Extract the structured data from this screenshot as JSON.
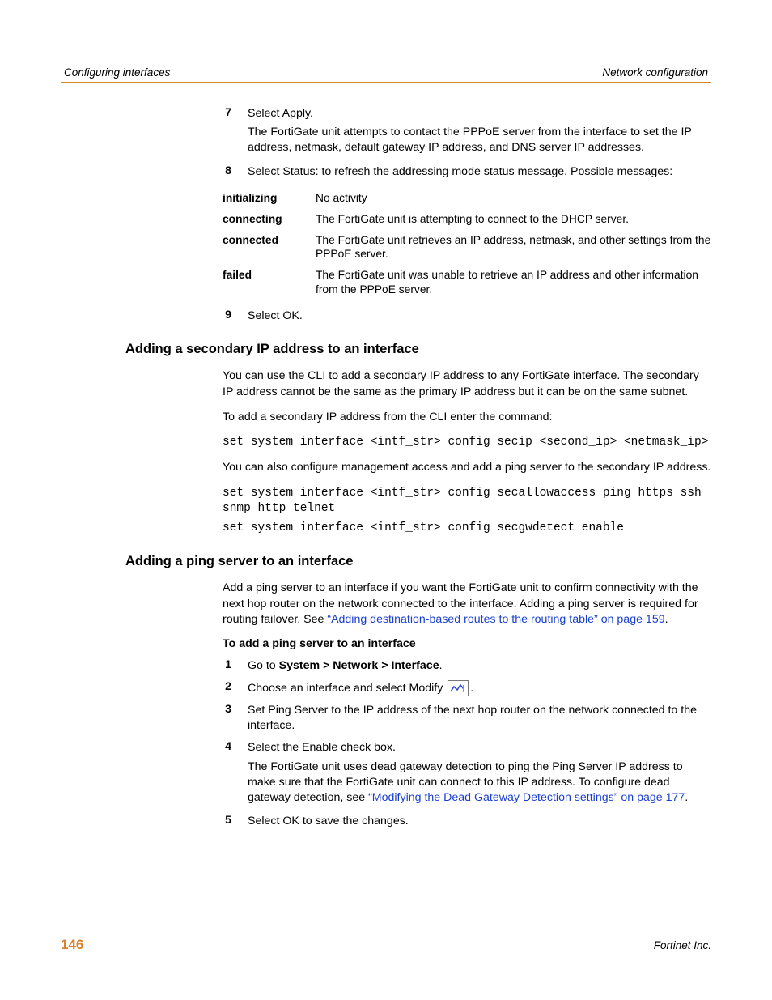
{
  "header": {
    "left": "Configuring interfaces",
    "right": "Network configuration"
  },
  "steps_top": {
    "s7_num": "7",
    "s7_a": "Select Apply.",
    "s7_b": "The FortiGate unit attempts to contact the PPPoE server from the interface to set the IP address, netmask, default gateway IP address, and DNS server IP addresses.",
    "s8_num": "8",
    "s8_a": "Select Status: to refresh the addressing mode status message. Possible messages:",
    "s9_num": "9",
    "s9_a": "Select OK."
  },
  "status": {
    "r1_term": "initializing",
    "r1_desc": "No activity",
    "r2_term": "connecting",
    "r2_desc": "The FortiGate unit is attempting to connect to the DHCP server.",
    "r3_term": "connected",
    "r3_desc": "The FortiGate unit retrieves an IP address, netmask, and other settings from the PPPoE server.",
    "r4_term": "failed",
    "r4_desc": "The FortiGate unit was unable to retrieve an IP address and other information from the PPPoE server."
  },
  "sec1": {
    "title": "Adding a secondary IP address to an interface",
    "p1": "You can use the CLI to add a secondary IP address to any FortiGate interface. The secondary IP address cannot be the same as the primary IP address but it can be on the same subnet.",
    "p2": "To add a secondary IP address from the CLI enter the command:",
    "code1": "set system interface <intf_str> config secip <second_ip> <netmask_ip>",
    "p3": "You can also configure management access and add a ping server to the secondary IP address.",
    "code2a": "set system interface <intf_str> config secallowaccess ping https ssh snmp http telnet",
    "code2b": "set system interface <intf_str> config secgwdetect enable"
  },
  "sec2": {
    "title": "Adding a ping server to an interface",
    "p1_a": "Add a ping server to an interface if you want the FortiGate unit to confirm connectivity with the next hop router on the network connected to the interface. Adding a ping server is required for routing failover. See ",
    "p1_link": "“Adding destination-based routes to the routing table” on page 159",
    "p1_c": ".",
    "subhead": "To add a ping server to an interface",
    "s1_num": "1",
    "s1_a": "Go to ",
    "s1_bold": "System > Network > Interface",
    "s1_c": ".",
    "s2_num": "2",
    "s2_a": "Choose an interface and select Modify ",
    "s2_c": ".",
    "s3_num": "3",
    "s3_a": "Set Ping Server to the IP address of the next hop router on the network connected to the interface.",
    "s4_num": "4",
    "s4_a": "Select the Enable check box.",
    "s4_b_a": "The FortiGate unit uses dead gateway detection to ping the Ping Server IP address to make sure that the FortiGate unit can connect to this IP address. To configure dead gateway detection, see ",
    "s4_b_link": "“Modifying the Dead Gateway Detection settings” on page 177",
    "s4_b_c": ".",
    "s5_num": "5",
    "s5_a": "Select OK to save the changes."
  },
  "footer": {
    "page": "146",
    "right": "Fortinet Inc."
  }
}
